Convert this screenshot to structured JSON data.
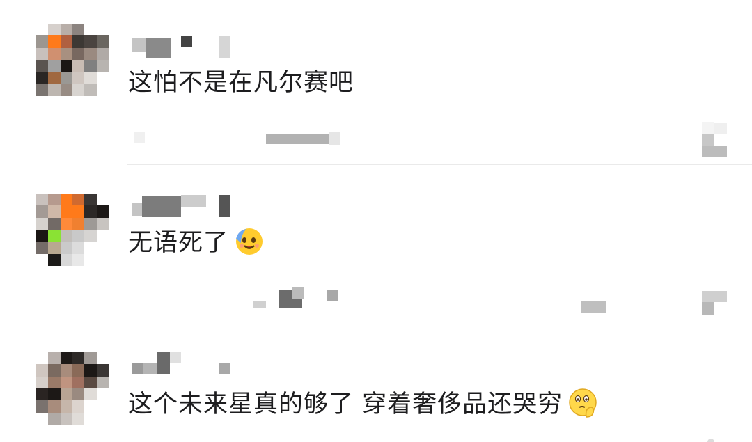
{
  "comments": [
    {
      "text": "这怕不是在凡尔赛吧",
      "emoji": ""
    },
    {
      "text": "无语死了",
      "emoji": "cold-sweat-smile-emoji"
    },
    {
      "text": "这个未来星真的够了 穿着奢侈品还哭穷",
      "emoji": "thinking-pleading-emoji"
    }
  ],
  "colors": {
    "text": "#1d1d1f",
    "divider": "#eaeaea",
    "accent_orange": "#ff7a1a",
    "accent_green": "#8ae234"
  }
}
